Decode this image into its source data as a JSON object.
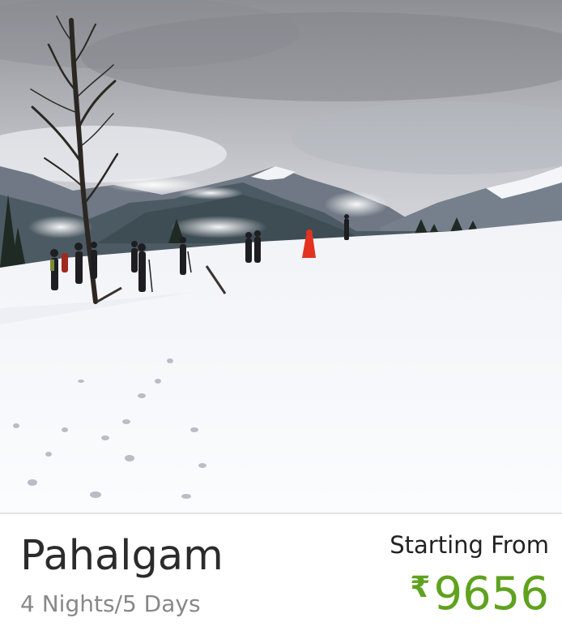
{
  "destination": {
    "name": "Pahalgam",
    "duration": "4 Nights/5 Days"
  },
  "pricing": {
    "label": "Starting From",
    "currency_symbol": "₹",
    "amount": "9656"
  },
  "colors": {
    "price": "#5fa21e",
    "title": "#2b2b2b",
    "subtitle": "#888888"
  },
  "image": {
    "icon": "snowy-mountain-landscape-photo"
  }
}
